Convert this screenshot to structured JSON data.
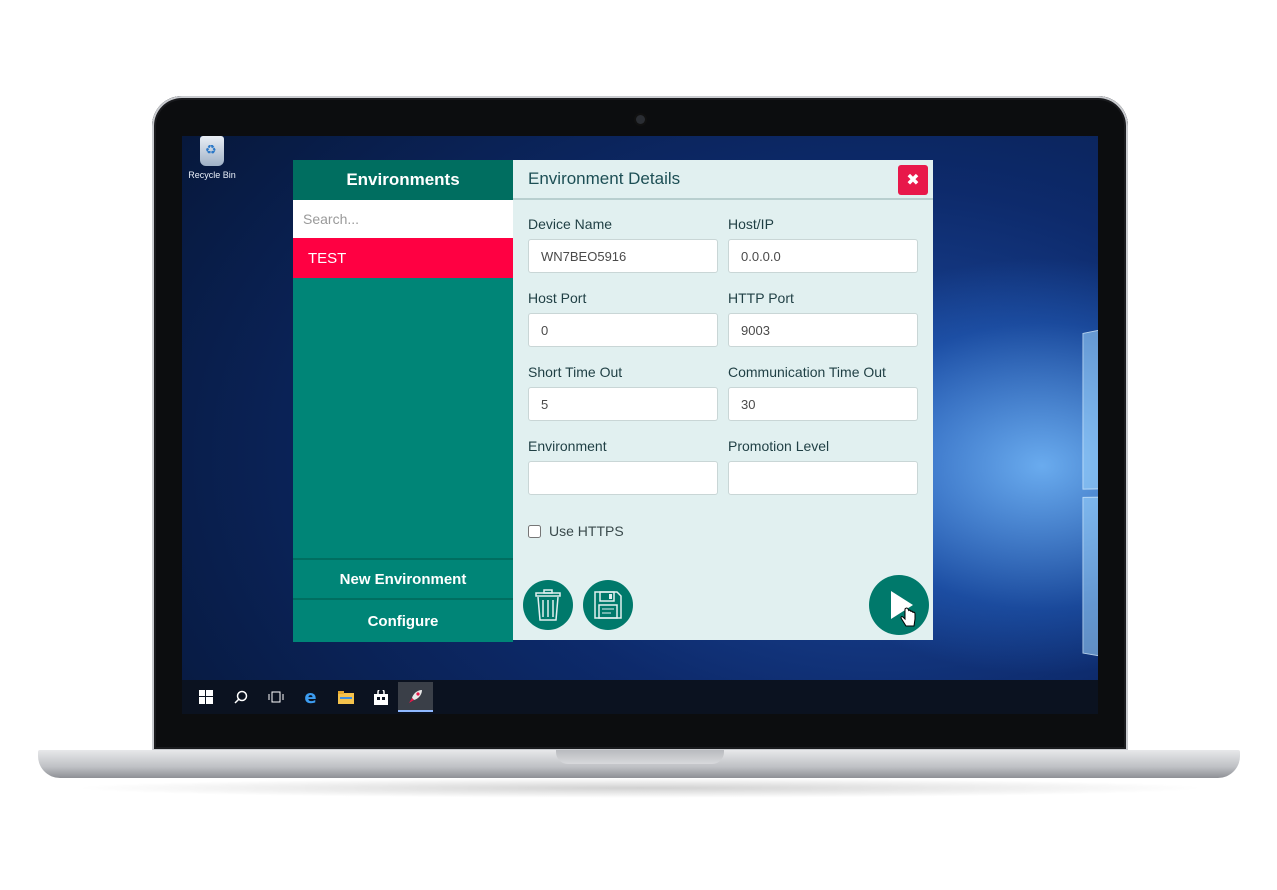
{
  "desktop": {
    "recycle_bin_label": "Recycle Bin"
  },
  "taskbar": {
    "items": [
      {
        "name": "start-icon",
        "glyph": "⊞"
      },
      {
        "name": "search-icon",
        "glyph": "⌕"
      },
      {
        "name": "task-view-icon",
        "glyph": "❐"
      },
      {
        "name": "edge-icon",
        "glyph": "e"
      },
      {
        "name": "file-explorer-icon",
        "glyph": "▬"
      },
      {
        "name": "store-icon",
        "glyph": "⛉"
      },
      {
        "name": "rocket-app-icon",
        "glyph": "🚀"
      }
    ]
  },
  "sidebar": {
    "title": "Environments",
    "search_placeholder": "Search...",
    "items": [
      {
        "label": "TEST",
        "selected": true
      }
    ],
    "new_environment_label": "New Environment",
    "configure_label": "Configure"
  },
  "details": {
    "title": "Environment Details",
    "fields": {
      "device_name": {
        "label": "Device Name",
        "value": "WN7BEO5916"
      },
      "host_ip": {
        "label": "Host/IP",
        "value": "0.0.0.0"
      },
      "host_port": {
        "label": "Host Port",
        "value": "0"
      },
      "http_port": {
        "label": "HTTP Port",
        "value": "9003"
      },
      "short_timeout": {
        "label": "Short Time Out",
        "value": "5"
      },
      "comm_timeout": {
        "label": "Communication Time Out",
        "value": "30"
      },
      "environment": {
        "label": "Environment",
        "value": ""
      },
      "promotion_level": {
        "label": "Promotion Level",
        "value": ""
      }
    },
    "use_https": {
      "label": "Use HTTPS",
      "checked": false
    }
  },
  "colors": {
    "accent_teal": "#008577",
    "header_teal": "#006e60",
    "selected_red": "#ff0042",
    "close_red": "#e8184a",
    "panel_bg": "#e1f0f0"
  }
}
